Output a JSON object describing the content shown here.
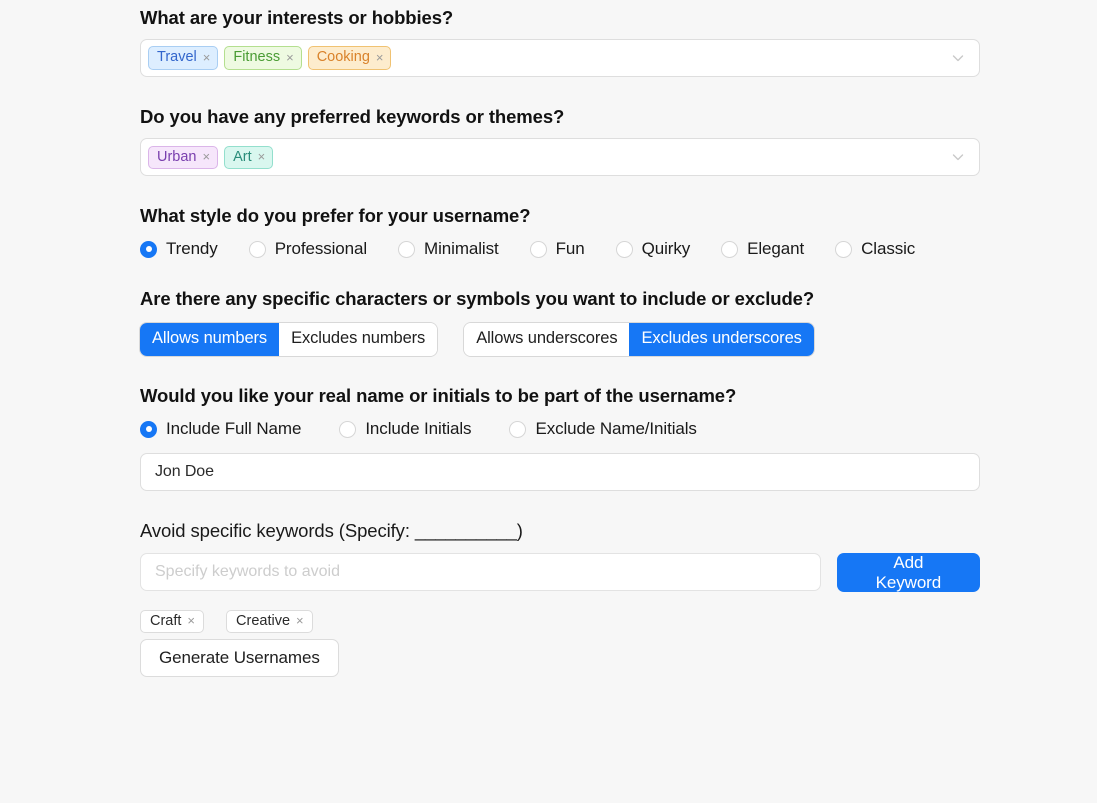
{
  "background_color": "#f7f7f7",
  "accent_color": "#1677f5",
  "sections": {
    "interests": {
      "question": "What are your interests or hobbies?",
      "chevron_icon": "chevron-down-icon",
      "tags": [
        {
          "label": "Travel",
          "remove_icon": "×",
          "style": "tag-blue"
        },
        {
          "label": "Fitness",
          "remove_icon": "×",
          "style": "tag-green"
        },
        {
          "label": "Cooking",
          "remove_icon": "×",
          "style": "tag-orange"
        }
      ]
    },
    "keywords_themes": {
      "question": "Do you have any preferred keywords or themes?",
      "chevron_icon": "chevron-down-icon",
      "tags": [
        {
          "label": "Urban",
          "remove_icon": "×",
          "style": "tag-purple"
        },
        {
          "label": "Art",
          "remove_icon": "×",
          "style": "tag-mint"
        }
      ]
    },
    "style": {
      "question": "What style do you prefer for your username?",
      "options": [
        {
          "label": "Trendy",
          "selected": true
        },
        {
          "label": "Professional",
          "selected": false
        },
        {
          "label": "Minimalist",
          "selected": false
        },
        {
          "label": "Fun",
          "selected": false
        },
        {
          "label": "Quirky",
          "selected": false
        },
        {
          "label": "Elegant",
          "selected": false
        },
        {
          "label": "Classic",
          "selected": false
        }
      ]
    },
    "characters": {
      "question": "Are there any specific characters or symbols you want to include or exclude?",
      "group_numbers": [
        {
          "label": "Allows numbers",
          "active": true
        },
        {
          "label": "Excludes numbers",
          "active": false
        }
      ],
      "group_underscores": [
        {
          "label": "Allows underscores",
          "active": false
        },
        {
          "label": "Excludes underscores",
          "active": true
        }
      ]
    },
    "real_name": {
      "question": "Would you like your real name or initials to be part of the username?",
      "options": [
        {
          "label": "Include Full Name",
          "selected": true
        },
        {
          "label": "Include Initials",
          "selected": false
        },
        {
          "label": "Exclude Name/Initials",
          "selected": false
        }
      ],
      "name_value": "Jon Doe",
      "name_placeholder": ""
    },
    "avoid": {
      "question": "Avoid specific keywords (Specify: __________)",
      "input_value": "",
      "input_placeholder": "Specify keywords to avoid",
      "add_button": "Add Keyword",
      "chips": [
        {
          "label": "Craft",
          "remove_icon": "×"
        },
        {
          "label": "Creative",
          "remove_icon": "×"
        }
      ]
    },
    "generate": {
      "button_label": "Generate Usernames"
    }
  }
}
